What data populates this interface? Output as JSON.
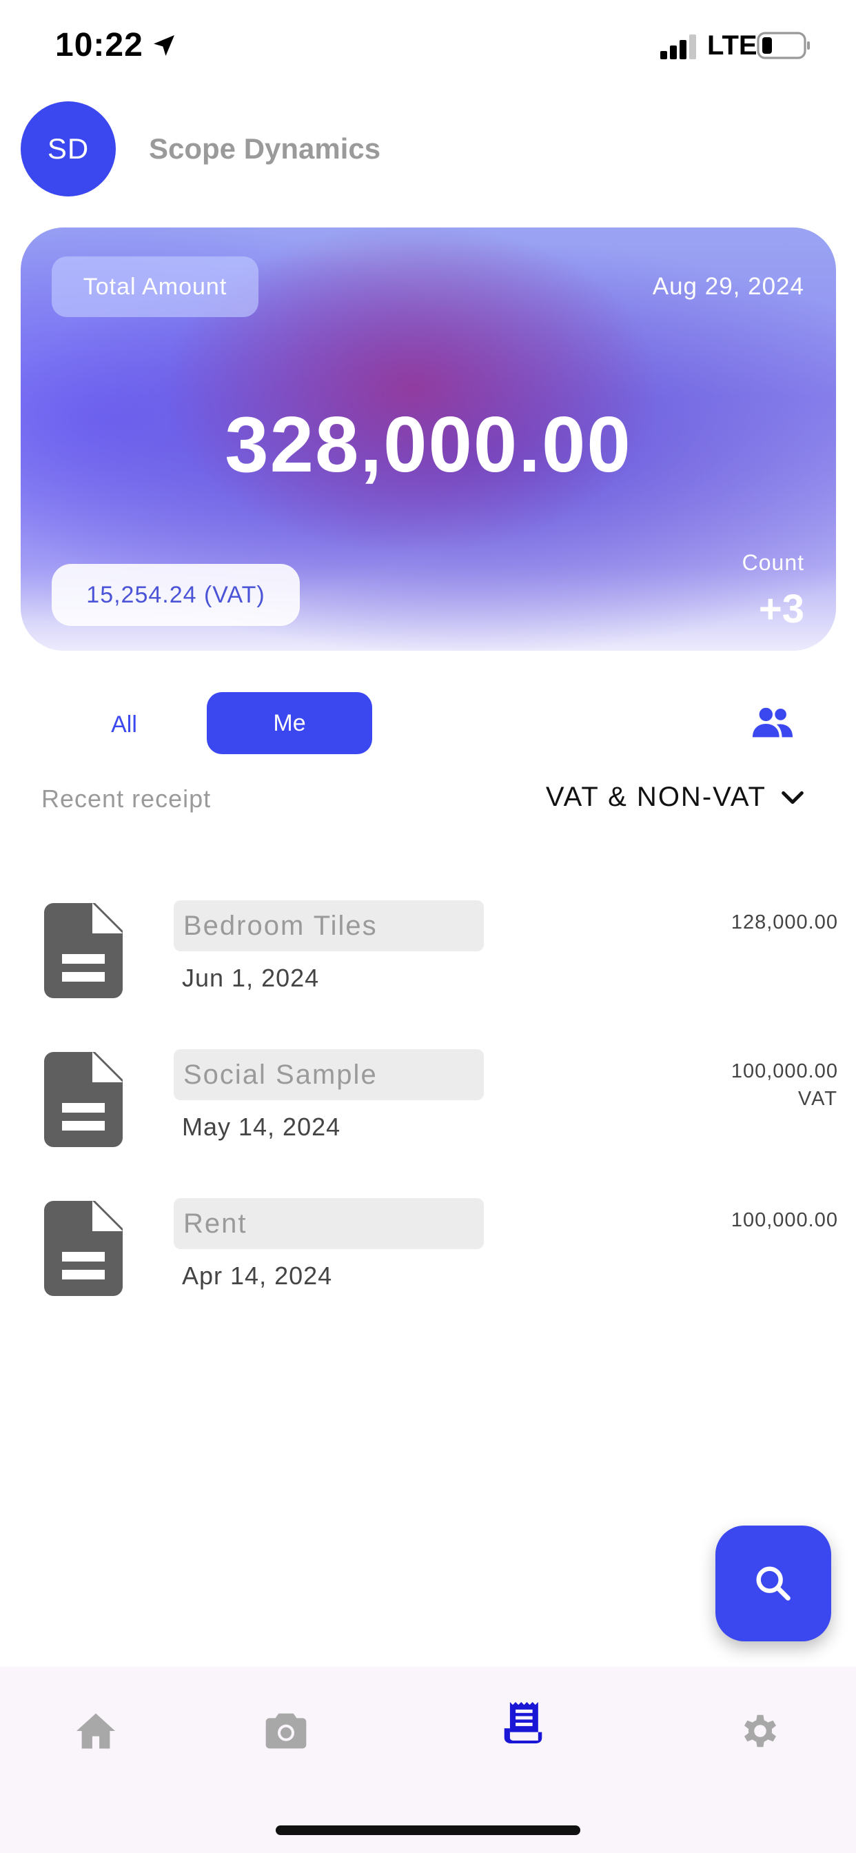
{
  "status_bar": {
    "time": "10:22",
    "network": "LTE"
  },
  "header": {
    "avatar_initials": "SD",
    "company_name": "Scope Dynamics"
  },
  "summary_card": {
    "label": "Total Amount",
    "date": "Aug 29, 2024",
    "amount": "328,000.00",
    "vat": "15,254.24 (VAT)",
    "count_label": "Count",
    "count_value": "+3"
  },
  "tabs": {
    "all": "All",
    "me": "Me",
    "selected": "Me"
  },
  "list_header": {
    "title": "Recent receipt",
    "filter": "VAT & NON-VAT"
  },
  "receipts": [
    {
      "name": "Bedroom Tiles",
      "date": "Jun 1, 2024",
      "amount": "128,000.00",
      "tag": ""
    },
    {
      "name": "Social Sample",
      "date": "May 14, 2024",
      "amount": "100,000.00",
      "tag": "VAT"
    },
    {
      "name": "Rent",
      "date": "Apr 14, 2024",
      "amount": "100,000.00",
      "tag": ""
    }
  ],
  "bottom_nav": {
    "items": [
      {
        "icon": "home-icon",
        "active": false
      },
      {
        "icon": "camera-icon",
        "active": false
      },
      {
        "icon": "receipt-icon",
        "active": true
      },
      {
        "icon": "gear-icon",
        "active": false
      }
    ]
  },
  "colors": {
    "accent": "#3b47ef",
    "muted": "#9a9a9a",
    "nav_bg": "#faf4fb"
  }
}
